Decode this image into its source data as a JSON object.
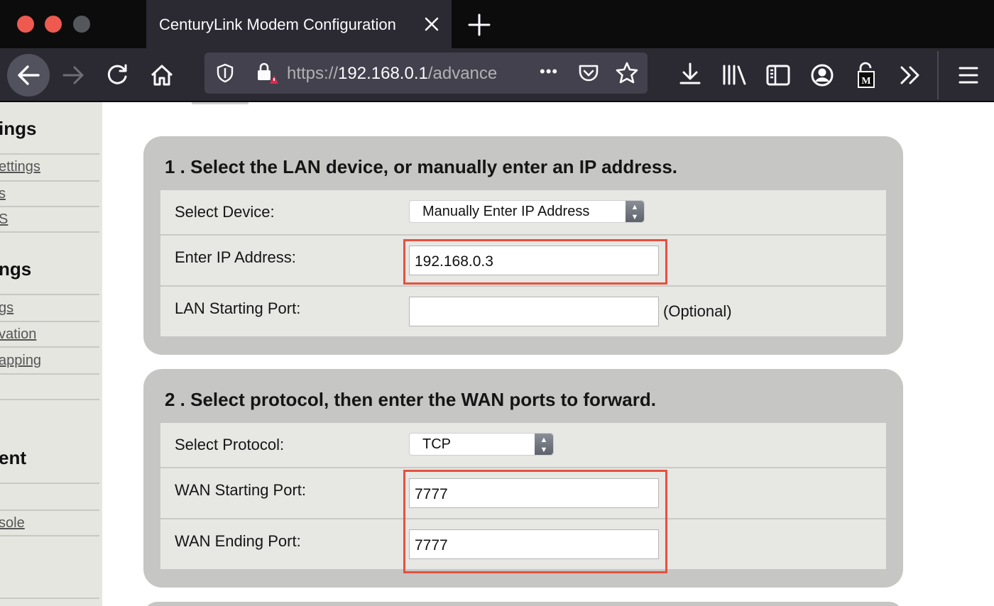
{
  "browser": {
    "tab_title": "CenturyLink Modem Configuration",
    "url_prefix": "https://",
    "url_host": "192.168.0.1",
    "url_rest": "/advance",
    "url_more": "•••"
  },
  "sidebar": {
    "sections": [
      {
        "heading": "ings",
        "links": [
          "ettings",
          "s",
          "S"
        ]
      },
      {
        "heading": "ngs",
        "links": [
          "gs",
          "vation",
          "apping"
        ]
      },
      {
        "heading": "ent",
        "links": [
          "sole"
        ]
      }
    ]
  },
  "section1": {
    "title": "1 . Select the LAN device, or manually enter an IP address.",
    "rows": [
      {
        "label": "Select Device:",
        "value": "Manually Enter IP Address"
      },
      {
        "label": "Enter IP Address:",
        "value": "192.168.0.3"
      },
      {
        "label": "LAN Starting Port:",
        "value": "",
        "note": "(Optional)"
      }
    ]
  },
  "section2": {
    "title": "2 . Select protocol, then enter the WAN ports to forward.",
    "rows": [
      {
        "label": "Select Protocol:",
        "value": "TCP"
      },
      {
        "label": "WAN Starting Port:",
        "value": "7777"
      },
      {
        "label": "WAN Ending Port:",
        "value": "7777"
      }
    ]
  },
  "colors": {
    "highlight": "#e4513f",
    "panel": "#c6c6c4",
    "table": "#e7e7e4",
    "chrome_dark": "#0c0c0d",
    "toolbar": "#2b2a33"
  }
}
